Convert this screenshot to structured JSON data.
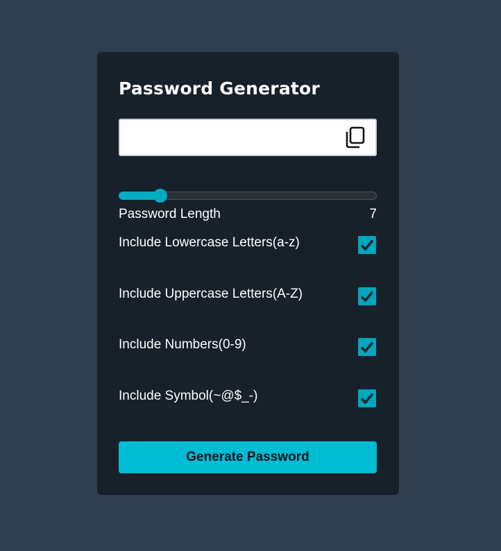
{
  "app": {
    "title": "Password Generator"
  },
  "output": {
    "value": "",
    "placeholder": "",
    "copy_icon": "copy-icon"
  },
  "length": {
    "label": "Password Length",
    "value": "7",
    "min": 4,
    "max": 32,
    "accent": "#00acc1"
  },
  "options": [
    {
      "label": "Include Lowercase Letters(a-z)",
      "checked": true
    },
    {
      "label": "Include Uppercase Letters(A-Z)",
      "checked": true
    },
    {
      "label": "Include Numbers(0-9)",
      "checked": true
    },
    {
      "label": "Include Symbol(~@$_-)",
      "checked": true
    }
  ],
  "actions": {
    "generate_label": "Generate Password"
  },
  "colors": {
    "background": "#2e3e50",
    "card": "#18202a",
    "accent": "#00bcd4",
    "checkbox": "#00a7bd"
  }
}
